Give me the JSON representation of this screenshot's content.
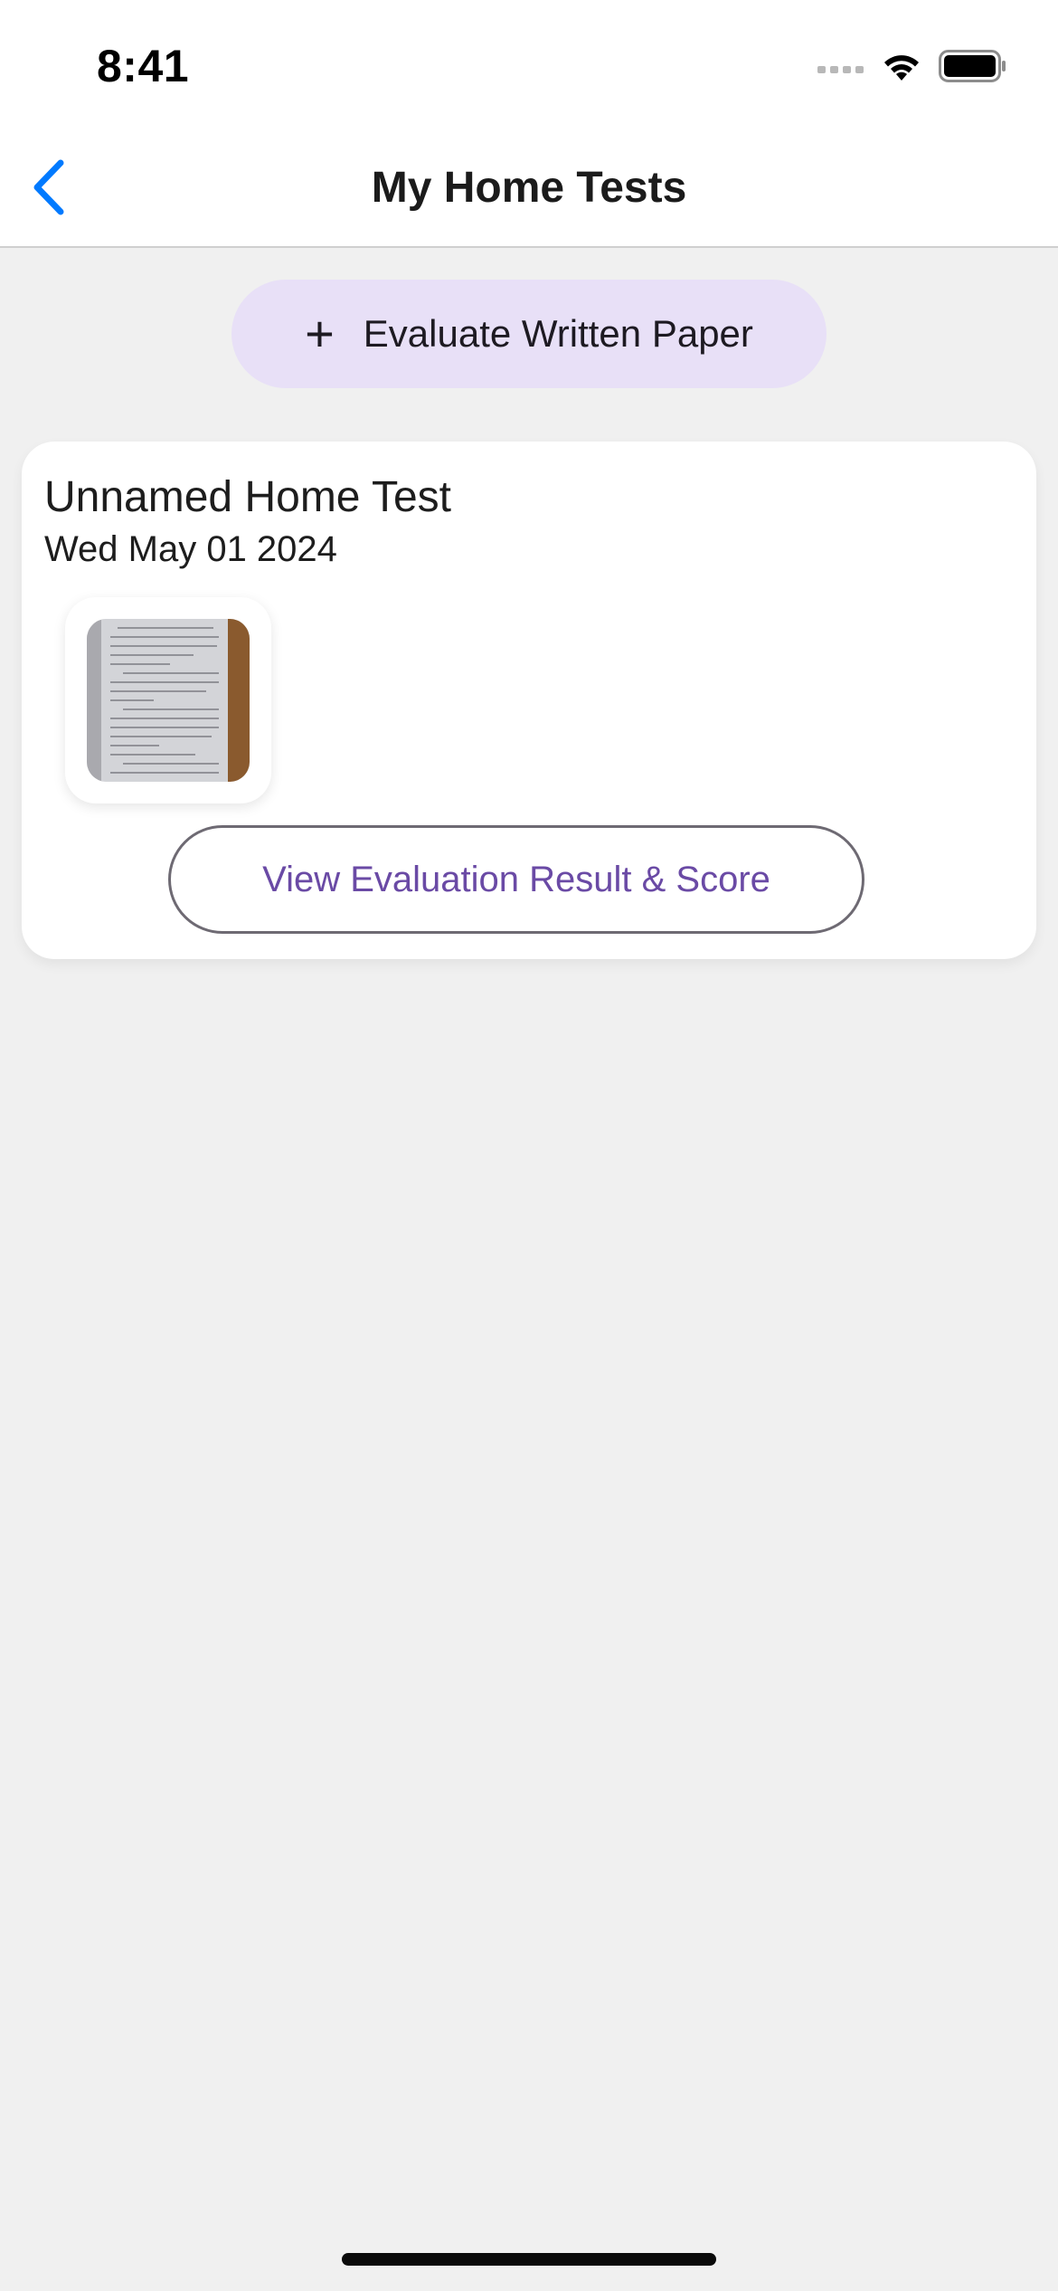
{
  "status_bar": {
    "time": "8:41",
    "icons": [
      "signal-icon",
      "wifi-icon",
      "battery-icon"
    ]
  },
  "nav": {
    "back_icon": "chevron-left-icon",
    "title": "My Home Tests"
  },
  "evaluate_button": {
    "icon": "plus-icon",
    "label": "Evaluate Written Paper"
  },
  "tests": [
    {
      "title": "Unnamed Home Test",
      "date": "Wed May 01 2024",
      "result_button_label": "View Evaluation Result & Score"
    }
  ],
  "colors": {
    "accent": "#007aff",
    "evaluate_button_bg": "#e8e0f7",
    "result_text": "#6a4aa5",
    "background": "#f0f0f0"
  }
}
